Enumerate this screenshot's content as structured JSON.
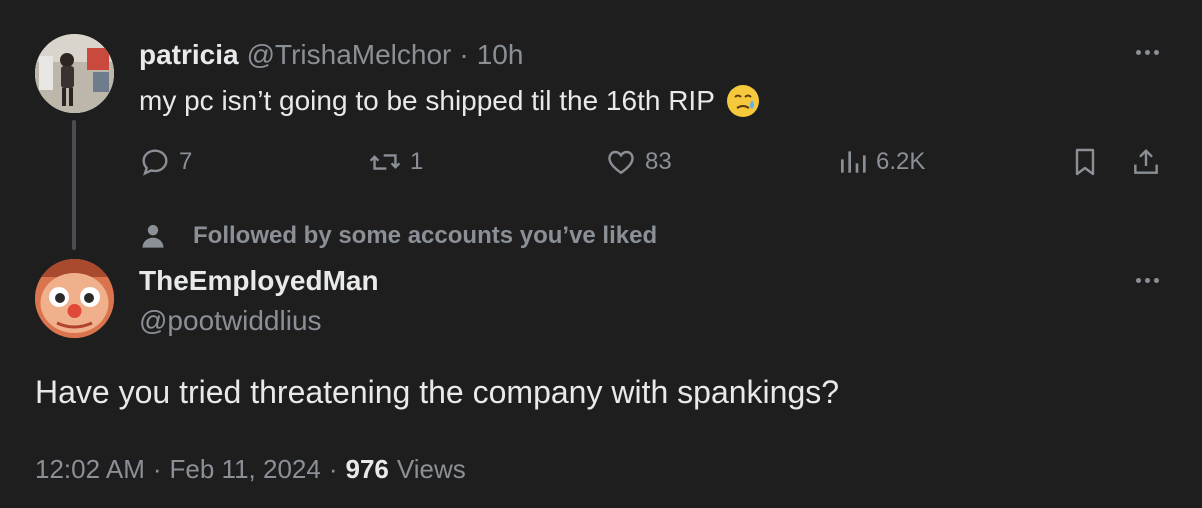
{
  "parent_tweet": {
    "display_name": "patricia",
    "handle": "@TrishaMelchor",
    "separator": "·",
    "time": "10h",
    "text": "my pc isn’t going to be shipped til the 16th RIP",
    "emoji": "face-holding-back-tears",
    "stats": {
      "replies": "7",
      "retweets": "1",
      "likes": "83",
      "views": "6.2K"
    }
  },
  "social_context": {
    "text": "Followed by some accounts you’ve liked",
    "icon": "person-icon"
  },
  "reply_tweet": {
    "display_name": "TheEmployedMan",
    "handle": "@pootwiddlius",
    "text": "Have you tried threatening the company with spankings?",
    "time": "12:02 AM",
    "separator": "·",
    "date": "Feb 11, 2024",
    "views_count": "976",
    "views_label": "Views"
  },
  "colors": {
    "background": "#1e1e1f",
    "primary_text": "#e7e9ea",
    "secondary_text": "#8b9096",
    "thread_line": "#4a4e52"
  }
}
